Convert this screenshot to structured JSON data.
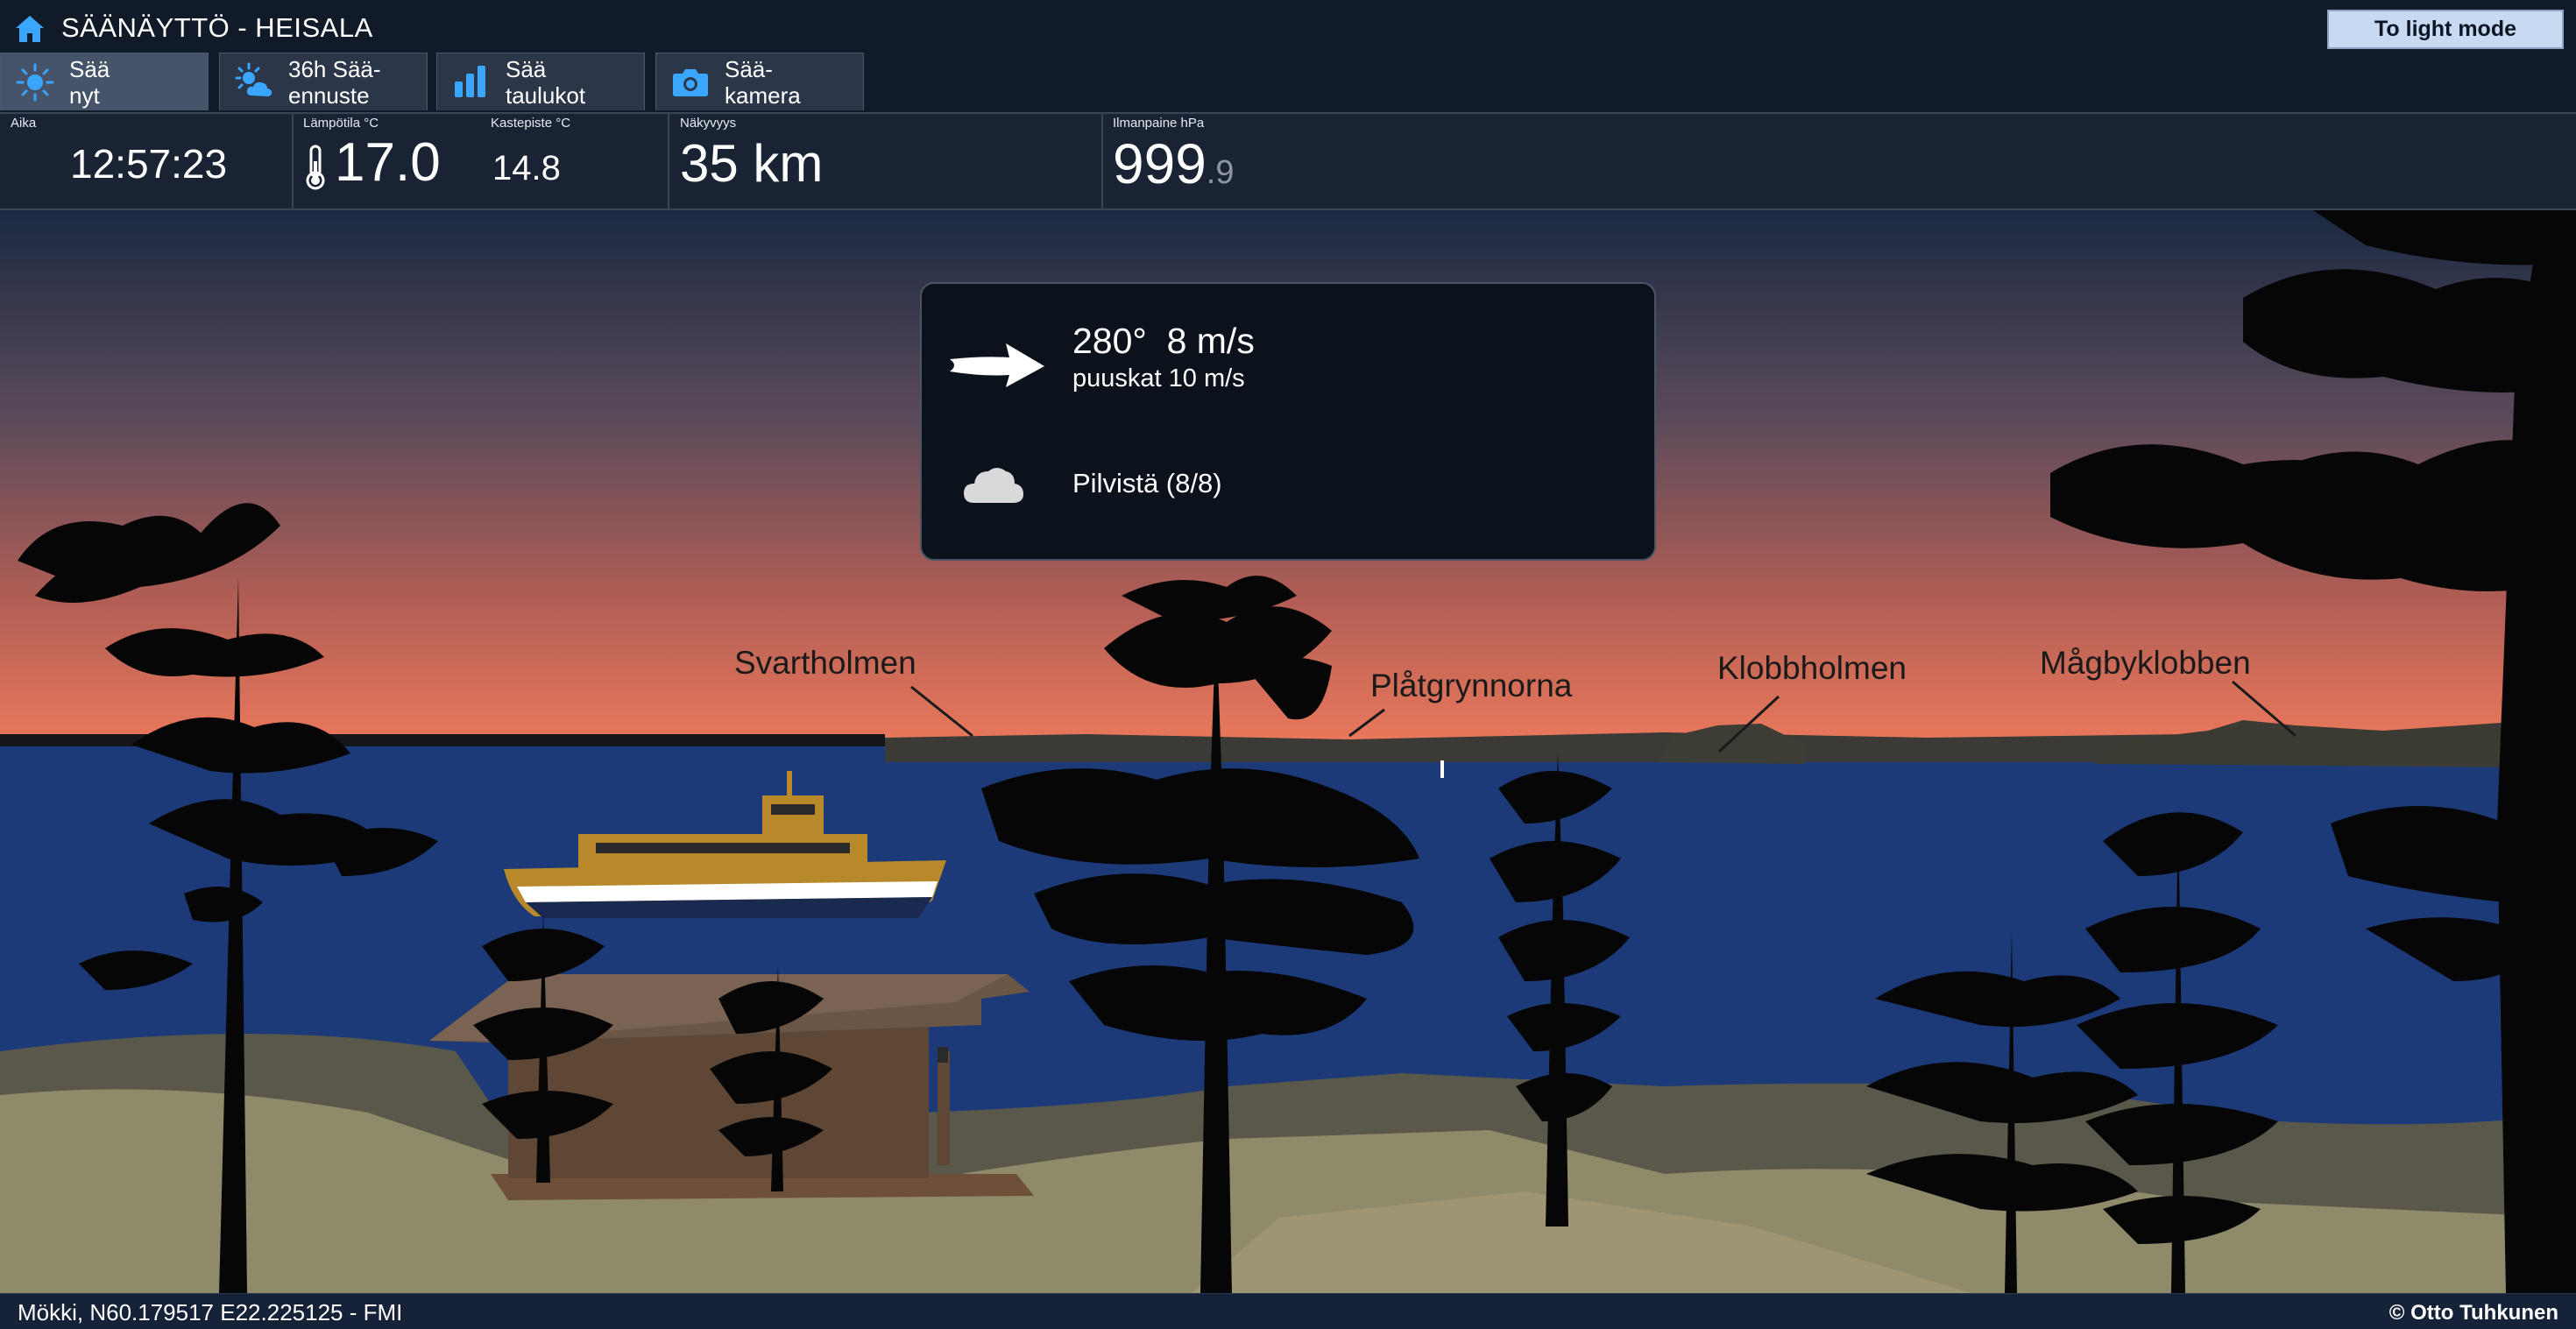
{
  "header": {
    "title": "SÄÄNÄYTTÖ - HEISALA",
    "theme_button": "To light mode",
    "tabs": [
      {
        "label": "Sää\nnyt",
        "icon": "sun-icon",
        "active": true
      },
      {
        "label": "36h Sää-\nennuste",
        "icon": "sun-cloud-icon",
        "active": false
      },
      {
        "label": "Sää\ntaulukot",
        "icon": "bar-chart-icon",
        "active": false
      },
      {
        "label": "Sää-\nkamera",
        "icon": "camera-icon",
        "active": false
      }
    ]
  },
  "stats": {
    "time": {
      "label": "Aika",
      "value": "12:57:23"
    },
    "temperature": {
      "label": "Lämpötila °C",
      "value": "17.0",
      "icon": "thermometer-icon"
    },
    "dewpoint": {
      "label": "Kastepiste °C",
      "value": "14.8"
    },
    "visibility": {
      "label": "Näkyvyys",
      "value": "35 km"
    },
    "pressure": {
      "label": "Ilmanpaine hPa",
      "value_int": "999",
      "value_dec": ".9"
    }
  },
  "weather": {
    "wind_main": "280°  8 m/s",
    "wind_gust": "puuskat 10 m/s",
    "wind_direction_deg": 280,
    "cloud_text": "Pilvistä (8/8)"
  },
  "places": [
    "Svartholmen",
    "Plåtgrynnorna",
    "Klobbholmen",
    "Mågbyklobben"
  ],
  "footer": {
    "location": "Mökki, N60.179517 E22.225125 - FMI",
    "credit": "© Otto Tuhkunen"
  },
  "colors": {
    "accent": "#3aa6ff",
    "sky_top": "#1b2942",
    "sky_bottom": "#e87a5e",
    "water": "#1c3a78"
  }
}
